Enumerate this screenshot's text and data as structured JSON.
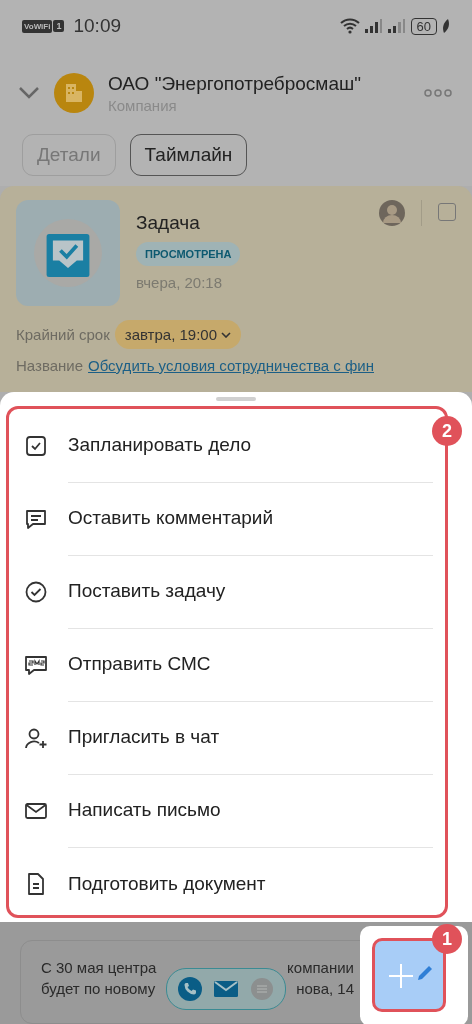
{
  "status_bar": {
    "wifi_badge": "VoWiFi",
    "sim_badge": "1",
    "time": "10:09",
    "battery": "60"
  },
  "header": {
    "title": "ОАО \"Энергопотребросмаш\"",
    "subtitle": "Компания"
  },
  "tabs": [
    {
      "label": "Детали",
      "selected": false
    },
    {
      "label": "Таймлайн",
      "selected": true
    }
  ],
  "task_card": {
    "title": "Задача",
    "status": "ПРОСМОТРЕНА",
    "time": "вчера, 20:18",
    "checked": false,
    "deadline_label": "Крайний срок",
    "deadline": "завтра, 19:00",
    "name_label": "Название",
    "name": "Обсудить условия сотрудничества с фин"
  },
  "action_sheet": {
    "badge": "2",
    "items": [
      {
        "kind": "plan",
        "label": "Запланировать дело"
      },
      {
        "kind": "comment",
        "label": "Оставить комментарий"
      },
      {
        "kind": "task",
        "label": "Поставить задачу"
      },
      {
        "kind": "sms",
        "label": "Отправить СМС"
      },
      {
        "kind": "invite",
        "label": "Пригласить в чат"
      },
      {
        "kind": "email",
        "label": "Написать письмо"
      },
      {
        "kind": "document",
        "label": "Подготовить документ"
      }
    ]
  },
  "comment_card": {
    "lines": [
      {
        "left": "С 30 мая центра",
        "right": "компании"
      },
      {
        "left": "будет по новому",
        "right": "нова, 14"
      }
    ]
  },
  "fab": {
    "badge": "1"
  }
}
